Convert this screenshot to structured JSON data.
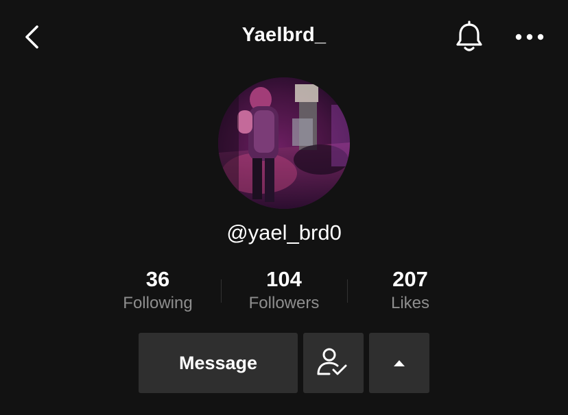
{
  "header": {
    "title": "Yaelbrd_",
    "back_icon": "chevron-left-icon",
    "notification_icon": "bell-icon",
    "more_icon": "more-horizontal-icon"
  },
  "profile": {
    "avatar_description": "profile-photo",
    "handle": "@yael_brd0"
  },
  "stats": [
    {
      "value": "36",
      "label": "Following"
    },
    {
      "value": "104",
      "label": "Followers"
    },
    {
      "value": "207",
      "label": "Likes"
    }
  ],
  "actions": {
    "message_label": "Message",
    "friend_icon": "user-check-icon",
    "expand_icon": "caret-up-icon"
  },
  "colors": {
    "background": "#121212",
    "button_bg": "#2f2f2f",
    "secondary_text": "#8e8e8e",
    "divider": "#333333"
  }
}
